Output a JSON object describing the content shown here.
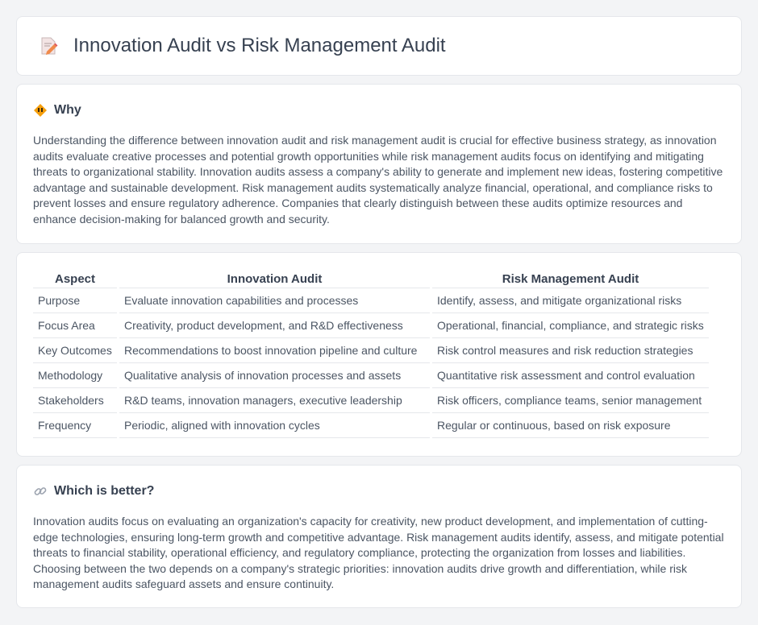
{
  "header": {
    "title": "Innovation Audit vs Risk Management Audit",
    "icon": "document-pencil-icon"
  },
  "why": {
    "heading": "Why",
    "icon": "diamond-warning-icon",
    "text": "Understanding the difference between innovation audit and risk management audit is crucial for effective business strategy, as innovation audits evaluate creative processes and potential growth opportunities while risk management audits focus on identifying and mitigating threats to organizational stability. Innovation audits assess a company's ability to generate and implement new ideas, fostering competitive advantage and sustainable development. Risk management audits systematically analyze financial, operational, and compliance risks to prevent losses and ensure regulatory adherence. Companies that clearly distinguish between these audits optimize resources and enhance decision-making for balanced growth and security."
  },
  "table": {
    "headers": [
      "Aspect",
      "Innovation Audit",
      "Risk Management Audit"
    ],
    "rows": [
      [
        "Purpose",
        "Evaluate innovation capabilities and processes",
        "Identify, assess, and mitigate organizational risks"
      ],
      [
        "Focus Area",
        "Creativity, product development, and R&D effectiveness",
        "Operational, financial, compliance, and strategic risks"
      ],
      [
        "Key Outcomes",
        "Recommendations to boost innovation pipeline and culture",
        "Risk control measures and risk reduction strategies"
      ],
      [
        "Methodology",
        "Qualitative analysis of innovation processes and assets",
        "Quantitative risk assessment and control evaluation"
      ],
      [
        "Stakeholders",
        "R&D teams, innovation managers, executive leadership",
        "Risk officers, compliance teams, senior management"
      ],
      [
        "Frequency",
        "Periodic, aligned with innovation cycles",
        "Regular or continuous, based on risk exposure"
      ]
    ]
  },
  "better": {
    "heading": "Which is better?",
    "icon": "link-icon",
    "text": "Innovation audits focus on evaluating an organization's capacity for creativity, new product development, and implementation of cutting-edge technologies, ensuring long-term growth and competitive advantage. Risk management audits identify, assess, and mitigate potential threats to financial stability, operational efficiency, and regulatory compliance, protecting the organization from losses and liabilities. Choosing between the two depends on a company's strategic priorities: innovation audits drive growth and differentiation, while risk management audits safeguard assets and ensure continuity."
  }
}
